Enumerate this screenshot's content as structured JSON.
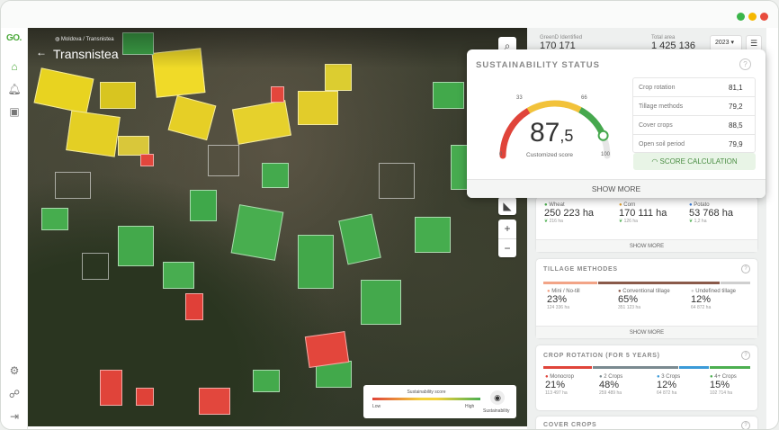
{
  "app": {
    "logo": "GO."
  },
  "window_dots": {
    "green": "#3ab54a",
    "yellow": "#f5b800",
    "red": "#e84c3d"
  },
  "map": {
    "breadcrumb": "Moldova / Transnistea",
    "title": "Transnistea",
    "legend": {
      "title": "Sustainability score",
      "low": "Low",
      "high": "High",
      "icon_label": "Sustainability"
    }
  },
  "header": {
    "identified_label": "GreenD Identified",
    "identified_value": "170 171",
    "area_label": "Total area",
    "area_value": "1 425 136",
    "year": "2023"
  },
  "sustainability": {
    "title": "SUSTAINABILITY STATUS",
    "score_int": "87",
    "score_dec": ",5",
    "score_caption": "Customized score",
    "score_fraction": 0.875,
    "gauge_labels": {
      "min": "0",
      "t1": "33",
      "t2": "66",
      "max": "100"
    },
    "metrics": [
      {
        "name": "Crop rotation",
        "value": "81,1"
      },
      {
        "name": "Tillage methods",
        "value": "79,2"
      },
      {
        "name": "Cover crops",
        "value": "88,5"
      },
      {
        "name": "Open soil period",
        "value": "79,9"
      }
    ],
    "button": "SCORE CALCULATION",
    "show_more": "SHOW MORE"
  },
  "crops": {
    "items": [
      {
        "label": "Wheat",
        "value": "250 223 ha",
        "sub": "216 ha",
        "color": "#4caf50"
      },
      {
        "label": "Corn",
        "value": "170 111 ha",
        "sub": "126 ha",
        "color": "#e0a030"
      },
      {
        "label": "Potato",
        "value": "53 768 ha",
        "sub": "1,2 ha",
        "color": "#3b7dd8"
      }
    ],
    "show_more": "SHOW MORE"
  },
  "tillage": {
    "title": "TILLAGE METHODES",
    "items": [
      {
        "label": "Mini / No-till",
        "pct": "23%",
        "ha": "124 336 ha",
        "color": "#f2a487"
      },
      {
        "label": "Conventional tillage",
        "pct": "65%",
        "ha": "351 123 ha",
        "color": "#8a5a4a"
      },
      {
        "label": "Undefined tillage",
        "pct": "12%",
        "ha": "64 872 ha",
        "color": "#cfcfcf"
      }
    ],
    "show_more": "SHOW MORE"
  },
  "rotation": {
    "title": "CROP ROTATION (FOR 5 YEARS)",
    "items": [
      {
        "label": "Monocrop",
        "pct": "21%",
        "ha": "113 497 ha",
        "color": "#e0443a"
      },
      {
        "label": "2 Crops",
        "pct": "48%",
        "ha": "259 489 ha",
        "color": "#7a8a90"
      },
      {
        "label": "3 Crops",
        "pct": "12%",
        "ha": "64 872 ha",
        "color": "#3b9ad8"
      },
      {
        "label": "4+ Crops",
        "pct": "15%",
        "ha": "102 714 ha",
        "color": "#4caf50"
      }
    ]
  },
  "cover": {
    "title": "COVER CROPS"
  }
}
